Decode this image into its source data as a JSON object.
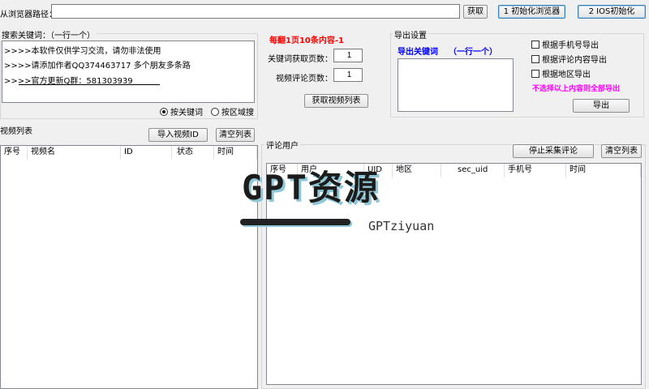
{
  "top": {
    "browser_path_label": "从浏览器路径：",
    "browser_path_value": "",
    "get_button": "获取",
    "init_browser_button": "1 初始化浏览器",
    "ios_init_button": "2 IOS初始化"
  },
  "search": {
    "title": "搜索关键词：（一行一个）",
    "lines": [
      ">>>>本软件仅供学习交流，请勿非法使用",
      ">>>>请添加作者QQ374463717 多个朋友多条路",
      ">>>>官方更新Q群：581303939"
    ],
    "radio_keyword": "按关键词",
    "radio_region": "按区域搜"
  },
  "settings": {
    "note": "每翻1页10条内容-1",
    "keyword_pages_label": "关键词获取页数：",
    "keyword_pages_value": "1",
    "comment_pages_label": "视频评论页数：",
    "comment_pages_value": "1",
    "get_video_list_button": "获取视频列表"
  },
  "export": {
    "title": "导出设置",
    "keywords_label": "导出关键词",
    "keywords_hint": "（一行一个）",
    "checkbox_phone": "根据手机号导出",
    "checkbox_comment": "根据评论内容导出",
    "checkbox_region": "根据地区导出",
    "all_hint": "不选择以上内容则全部导出",
    "export_button": "导出"
  },
  "video_list": {
    "title": "视频列表",
    "import_button": "导入视频ID",
    "clear_button": "清空列表",
    "columns": [
      "序号",
      "视频名",
      "ID",
      "状态",
      "时间"
    ]
  },
  "comment_users": {
    "title": "评论用户",
    "stop_button": "停止采集评论",
    "clear_button": "清空列表",
    "columns": [
      "序号",
      "用户",
      "UID",
      "地区",
      "sec_uid",
      "手机号",
      "时间"
    ]
  },
  "watermark": {
    "big": "GPT资源",
    "small": "GPTziyuan"
  },
  "colors": {
    "note_red": "#ff0000",
    "blue_label": "#0000ff",
    "magenta_hint": "#ff00ff",
    "window_bg": "#f0f0f0"
  }
}
